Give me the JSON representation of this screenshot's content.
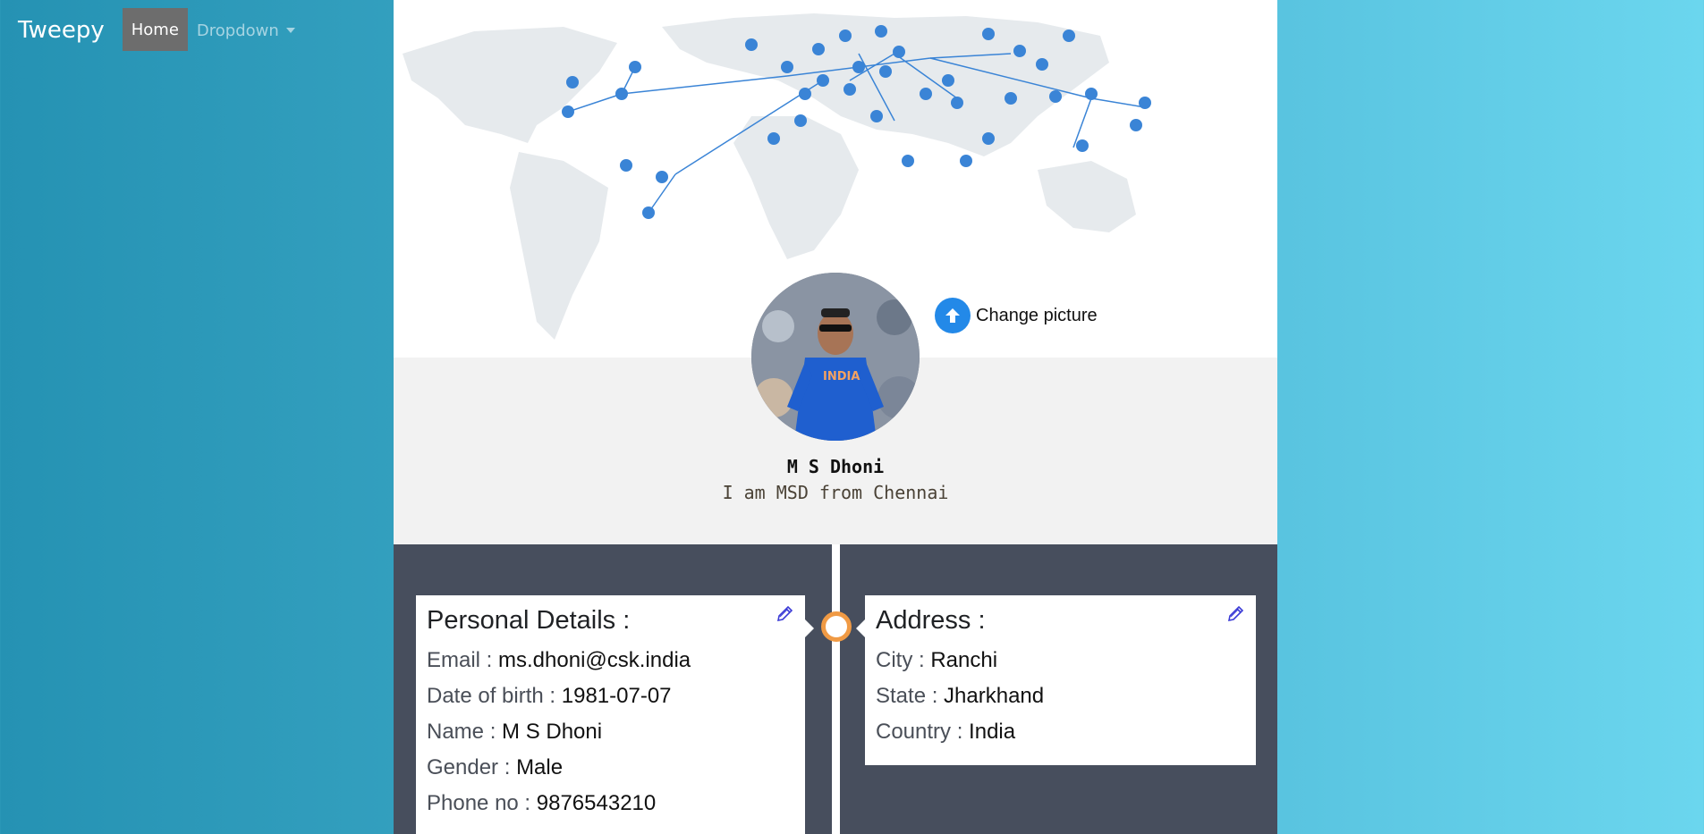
{
  "navbar": {
    "brand": "Tweepy",
    "home_label": "Home",
    "dropdown_label": "Dropdown"
  },
  "profile": {
    "change_picture_label": "Change picture",
    "name": "M S Dhoni",
    "bio": "I am MSD from Chennai"
  },
  "personal": {
    "title": "Personal Details :",
    "rows": [
      {
        "label": "Email : ",
        "value": "ms.dhoni@csk.india"
      },
      {
        "label": "Date of birth : ",
        "value": "1981-07-07"
      },
      {
        "label": "Name : ",
        "value": "M S Dhoni"
      },
      {
        "label": "Gender : ",
        "value": "Male"
      },
      {
        "label": "Phone no : ",
        "value": "9876543210"
      }
    ]
  },
  "address": {
    "title": "Address :",
    "rows": [
      {
        "label": "City : ",
        "value": "Ranchi"
      },
      {
        "label": "State : ",
        "value": "Jharkhand"
      },
      {
        "label": "Country : ",
        "value": "India"
      }
    ]
  },
  "colors": {
    "timeline_bg": "#474e5d",
    "timeline_dot": "#f09a44",
    "upload_button": "#2389e8",
    "edit_icon": "#3b3bd6"
  },
  "icons": {
    "upload": "upload-arrow-icon",
    "edit": "pencil-icon"
  }
}
